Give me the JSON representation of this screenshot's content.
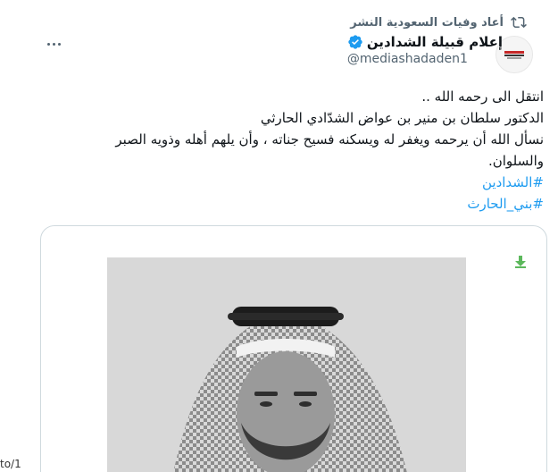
{
  "retweet": {
    "label": "أعاد وفيات السعودية النشر",
    "icon": "retweet-icon"
  },
  "author": {
    "name": "إعلام قبيلة الشدادين",
    "handle": "@mediashadaden1",
    "verified_icon": "verified-badge-icon",
    "verified_color": "#1d9bf0"
  },
  "post": {
    "lines": [
      "انتقل الى رحمه الله ..",
      "الدكتور سلطان بن منير بن عواض الشدّادي الحارثي",
      "نسأل الله أن يرحمه ويغفر له ويسكنه فسيح جناته ، وأن يلهم أهله وذويه الصبر",
      "والسلوان."
    ],
    "hashtags": [
      "#الشدادين",
      "#بني_الحارث"
    ],
    "hashtag_color": "#1d9bf0"
  },
  "media": {
    "download_icon": "download-arrow-icon",
    "download_color": "#5cb85c"
  },
  "edge": {
    "text": "to/1"
  },
  "more_icon": "more-options-icon"
}
